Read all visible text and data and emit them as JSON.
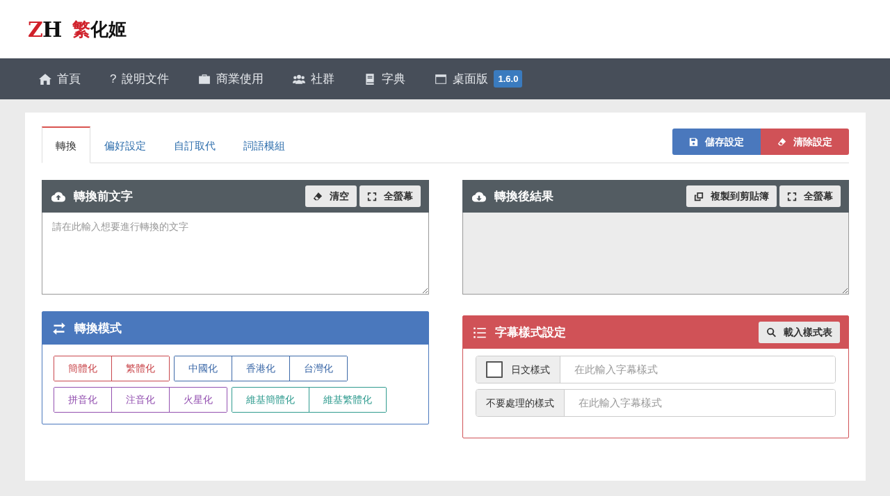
{
  "logo": {
    "mark": "ZH",
    "name": "繁化姬"
  },
  "nav": [
    {
      "kind": "home",
      "label": "首頁"
    },
    {
      "kind": "glyph",
      "glyph": "?",
      "label": "說明文件"
    },
    {
      "kind": "business",
      "label": "商業使用"
    },
    {
      "kind": "community",
      "label": "社群"
    },
    {
      "kind": "dictionary",
      "label": "字典"
    },
    {
      "kind": "desktop",
      "label": "桌面版",
      "badge": "1.6.0"
    }
  ],
  "tabs": [
    {
      "label": "轉換",
      "selected": true
    },
    {
      "label": "偏好設定",
      "selected": false
    },
    {
      "label": "自訂取代",
      "selected": false
    },
    {
      "label": "詞語模組",
      "selected": false
    }
  ],
  "settings_buttons": [
    {
      "kind": "save",
      "label": "儲存設定"
    },
    {
      "kind": "clear",
      "label": "清除設定"
    }
  ],
  "input_panel": {
    "title": "轉換前文字",
    "buttons": [
      {
        "kind": "clear",
        "label": "清空"
      },
      {
        "kind": "fullscreen",
        "label": "全螢幕"
      }
    ],
    "placeholder": "請在此輸入想要進行轉換的文字"
  },
  "output_panel": {
    "title": "轉換後結果",
    "buttons": [
      {
        "kind": "copy",
        "label": "複製到剪貼簿"
      },
      {
        "kind": "fullscreen",
        "label": "全螢幕"
      }
    ],
    "readonly": true
  },
  "mode_panel": {
    "title": "轉換模式",
    "groups": [
      {
        "color": "#c9474c",
        "buttons": [
          "簡體化",
          "繁體化"
        ]
      },
      {
        "color": "#3c69a8",
        "buttons": [
          "中國化",
          "香港化",
          "台灣化"
        ]
      },
      {
        "color": "#9350b0",
        "buttons": [
          "拼音化",
          "注音化",
          "火星化"
        ]
      },
      {
        "color": "#2f9b8f",
        "buttons": [
          "維基簡體化",
          "維基繁體化"
        ]
      }
    ]
  },
  "subtitle_panel": {
    "title": "字幕樣式設定",
    "button": "載入樣式表",
    "rows": [
      {
        "kind": "checkbox",
        "label": "日文樣式",
        "checked": false,
        "placeholder": "在此輸入字幕樣式"
      },
      {
        "kind": "plain",
        "label": "不要處理的樣式",
        "placeholder": "在此輸入字幕樣式"
      }
    ]
  }
}
